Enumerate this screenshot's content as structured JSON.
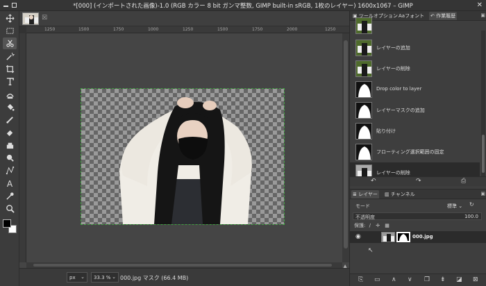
{
  "window": {
    "title": "*[000] (インポートされた画像)-1.0 (RGB カラー 8 bit ガンマ整数, GIMP built-in sRGB, 1枚のレイヤー) 1600x1067 – GIMP",
    "close_glyph": "✕"
  },
  "image_tab": {
    "close_glyph": "☒"
  },
  "rulers": {
    "ticks": [
      "1250",
      "1500",
      "1750",
      "1000",
      "1250",
      "1500",
      "1750",
      "2000",
      "1250"
    ]
  },
  "status": {
    "unit": "px",
    "zoom": "33.3 %",
    "info": "000.jpg マスク (66.4 MB)"
  },
  "dock_top": {
    "tabs": [
      {
        "label": "ツールオプション",
        "icon": "tool-options-icon"
      },
      {
        "label": "フォント",
        "icon": "font-icon"
      },
      {
        "label": "作業履歴",
        "icon": "history-icon",
        "active": true
      }
    ]
  },
  "history": {
    "items": [
      {
        "label": "",
        "thumb": "photo"
      },
      {
        "label": "レイヤーの追加",
        "thumb": "photo"
      },
      {
        "label": "レイヤーの削除",
        "thumb": "photo"
      },
      {
        "label": "Drop color to layer",
        "thumb": "mask"
      },
      {
        "label": "レイヤーマスクの追加",
        "thumb": "mask"
      },
      {
        "label": "貼り付け",
        "thumb": "mask"
      },
      {
        "label": "フローティング選択範囲の固定",
        "thumb": "mask"
      },
      {
        "label": "レイヤーの削除",
        "thumb": "photo",
        "selected": true
      }
    ],
    "buttons": [
      "undo-icon",
      "redo-icon",
      "clear-history-icon"
    ]
  },
  "dock_bottom": {
    "tabs": [
      {
        "label": "レイヤー",
        "icon": "layers-icon",
        "active": true
      },
      {
        "label": "チャンネル",
        "icon": "channels-icon"
      }
    ]
  },
  "layers": {
    "mode_label": "モード",
    "mode_value": "標準",
    "opacity_label": "不透明度",
    "opacity_value": "100.0",
    "lock_label": "保護:",
    "items": [
      {
        "name": "000.jpg",
        "visible": true
      }
    ]
  },
  "colors": {
    "selection": "#3fa23f",
    "fg": "#000000",
    "bg": "#ffffff"
  }
}
